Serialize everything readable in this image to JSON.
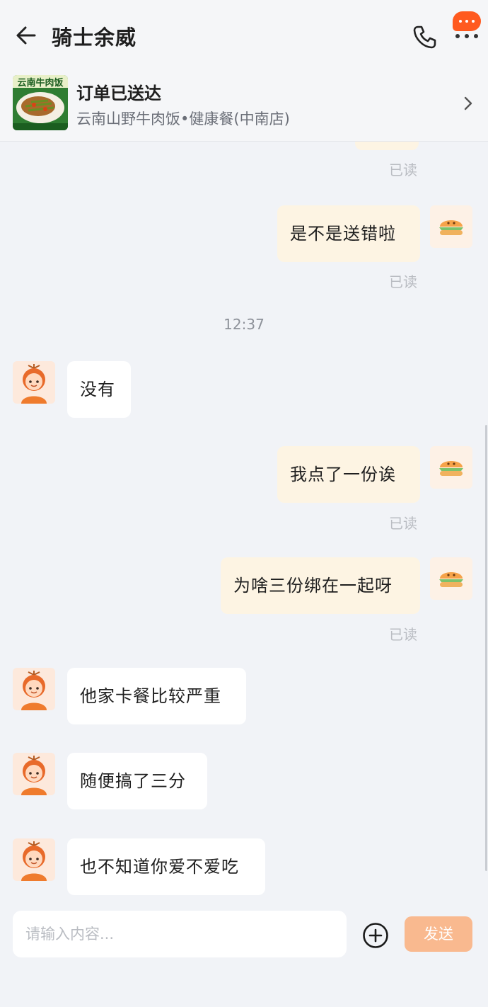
{
  "header": {
    "title": "骑士余威",
    "back_icon": "arrow-left-icon",
    "call_icon": "phone-icon",
    "more_icon": "more-icon",
    "accent": "#ff5a1f"
  },
  "order": {
    "status": "订单已送达",
    "store": "云南山野牛肉饭•健康餐(中南店)",
    "thumb_text": "云南牛肉饭"
  },
  "chat": {
    "read_label": "已读",
    "time_label": "12:37",
    "messages": [
      {
        "from": "me",
        "text": "是不是送错啦"
      },
      {
        "from": "rider",
        "text": "没有"
      },
      {
        "from": "me",
        "text": "我点了一份诶"
      },
      {
        "from": "me",
        "text": "为啥三份绑在一起呀"
      },
      {
        "from": "rider",
        "text": "他家卡餐比较严重"
      },
      {
        "from": "rider",
        "text": "随便搞了三分"
      },
      {
        "from": "rider",
        "text": "也不知道你爱不爱吃"
      }
    ]
  },
  "composer": {
    "placeholder": "请输入内容...",
    "send_label": "发送",
    "plus_icon": "plus-circle-icon"
  },
  "colors": {
    "my_bubble": "#fdf4e3",
    "rider_bubble": "#ffffff",
    "send_button": "#f9b98f",
    "background": "#f1f3f7"
  }
}
